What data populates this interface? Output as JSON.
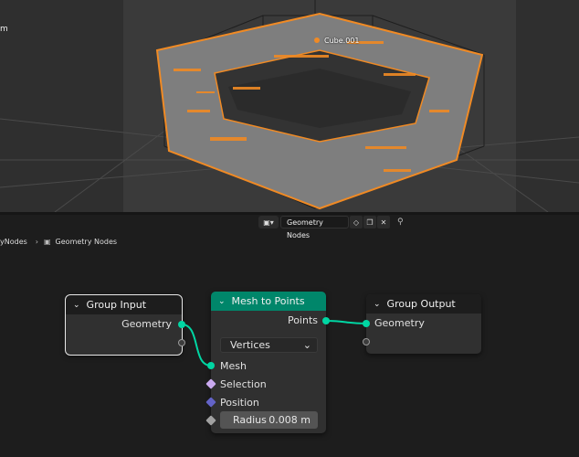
{
  "viewport": {
    "side_label": "m",
    "object_label": "Cube.001",
    "colors": {
      "background": "#3a3a3a",
      "mesh": "#8a8a8a",
      "selection": "#f08a24"
    }
  },
  "node_tree_header": {
    "editor_type_icon": "node-editor-icon",
    "node_group_name": "Geometry Nodes",
    "buttons": [
      "fake-user-shield-icon",
      "duplicate-icon",
      "unlink-icon"
    ],
    "pin_icon": "pin-icon"
  },
  "breadcrumb": {
    "items": [
      "yNodes",
      "Geometry Nodes"
    ],
    "separator": "›"
  },
  "nodes": {
    "group_input": {
      "title": "Group Input",
      "outputs": [
        "Geometry"
      ]
    },
    "mesh_to_points": {
      "title": "Mesh to Points",
      "output": "Points",
      "mode_dropdown": "Vertices",
      "inputs": [
        "Mesh",
        "Selection",
        "Position"
      ],
      "radius_label": "Radius",
      "radius_value": "0.008 m"
    },
    "group_output": {
      "title": "Group Output",
      "inputs": [
        "Geometry"
      ]
    }
  },
  "colors": {
    "geometry_socket": "#00d6a3",
    "geometry_header": "#00866a",
    "selection_socket": "#c9a9ef",
    "position_socket": "#6363c7",
    "radius_socket": "#a1a1a1"
  }
}
